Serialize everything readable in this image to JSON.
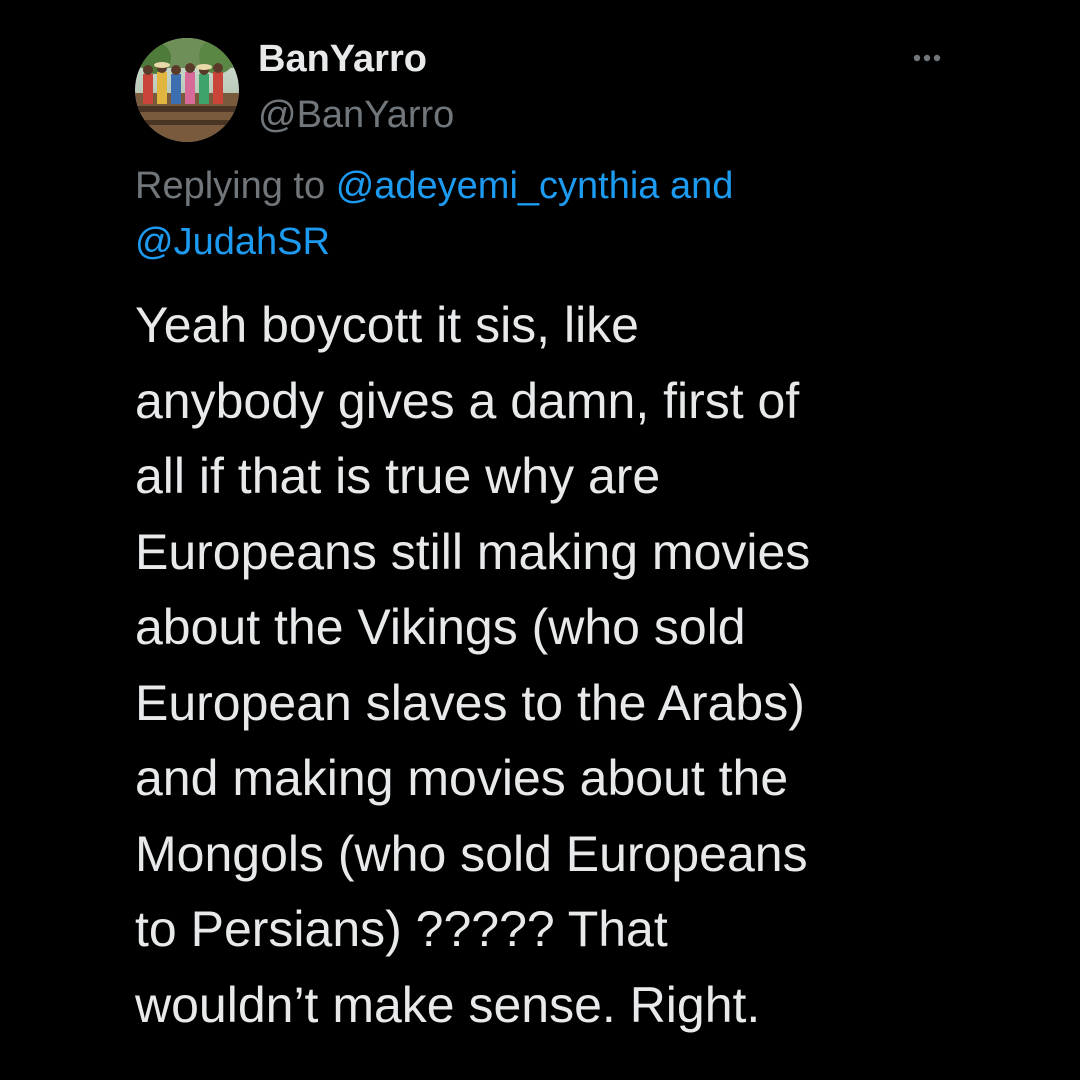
{
  "tweet": {
    "author": {
      "display_name": "BanYarro",
      "handle": "@BanYarro",
      "avatar_icon": "profile-photo-avatar"
    },
    "more_icon": "more-horizontal-icon",
    "reply": {
      "prefix": "Replying to",
      "mentions": [
        "@adeyemi_cynthia",
        "@JudahSR"
      ],
      "conjunction": "and"
    },
    "text": "Yeah boycott it sis, like\nanybody gives a damn, first of\nall if that is true why are\nEuropeans still making movies\nabout the Vikings (who sold\nEuropean slaves to the Arabs)\nand making movies about the\nMongols (who sold Europeans\nto Persians) ????? That\nwouldn’t make sense. Right."
  },
  "colors": {
    "background": "#000000",
    "primary_text": "#e7e9ea",
    "secondary_text": "#71767b",
    "link": "#1d9bf0"
  }
}
